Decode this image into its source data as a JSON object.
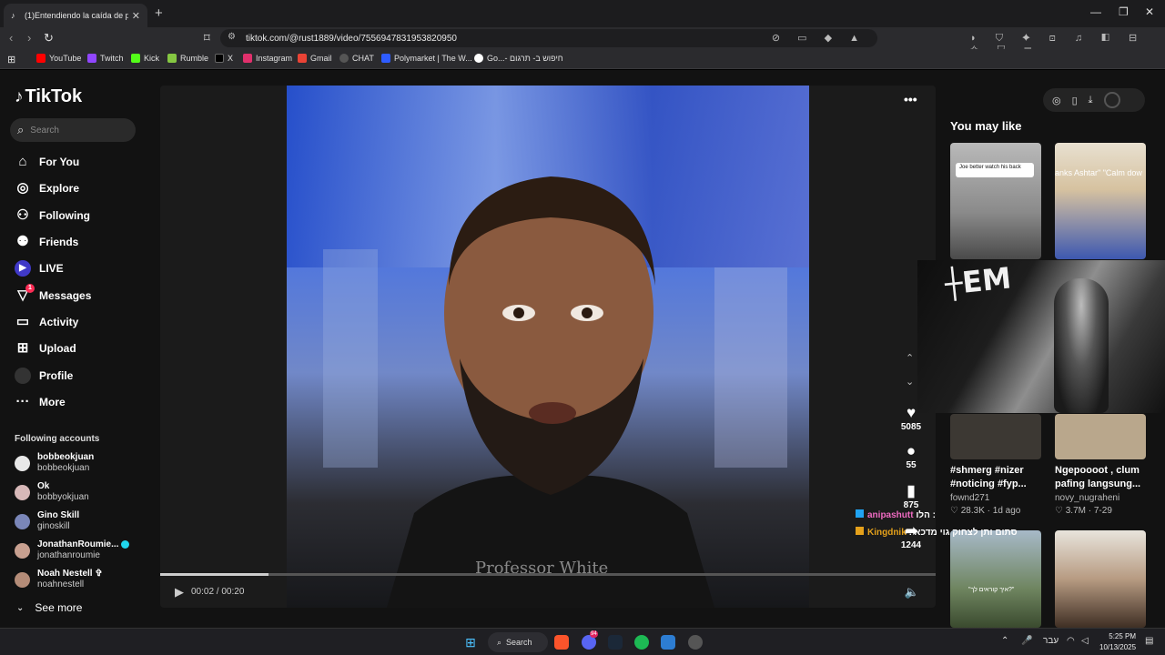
{
  "browser": {
    "tab_title": "(1)Entendiendo la caída de polít",
    "url": "tiktok.com/@rust1889/video/7556947831953820950",
    "bookmarks": [
      "YouTube",
      "Twitch",
      "Kick",
      "Rumble",
      "X",
      "Instagram",
      "Gmail",
      "CHAT",
      "Polymarket | The W...",
      "Go...- חיפוש ב- תרגום"
    ]
  },
  "sidebar": {
    "logo": "TikTok",
    "search_placeholder": "Search",
    "nav": [
      "For You",
      "Explore",
      "Following",
      "Friends",
      "LIVE",
      "Messages",
      "Activity",
      "Upload",
      "Profile",
      "More"
    ],
    "messages_badge": "1",
    "following_header": "Following accounts",
    "accounts": [
      {
        "name": "bobbeokjuan",
        "handle": "bobbeokjuan"
      },
      {
        "name": "Ok",
        "handle": "bobbyokjuan"
      },
      {
        "name": "Gino Skill",
        "handle": "ginoskill"
      },
      {
        "name": "JonathanRoumie...",
        "handle": "jonathanroumie"
      },
      {
        "name": "Noah Nestell ✞",
        "handle": "noahnestell"
      }
    ],
    "see_more": "See more"
  },
  "video": {
    "watermark": "Professor White",
    "time": "00:02 / 00:20",
    "progress": 0.14,
    "author": "rust1889",
    "likes": "5085",
    "comments": "55",
    "saves": "875",
    "shares": "1244"
  },
  "chat": [
    {
      "user": "anipashutt",
      "msg": "הלו :"
    },
    {
      "user": "Kingdnik",
      "msg": ": סתום ותן לצחוק גוי מדכא"
    }
  ],
  "you_may_like": {
    "header": "You may like",
    "cards": [
      {
        "caption": "#shmerg #nizer #noticing #fyp...",
        "user": "fownd271",
        "views": "28.3K",
        "date": "1d ago",
        "overlay_text": "Joe better watch his back"
      },
      {
        "caption": "Ngepoooot , clum pafing langsung...",
        "user": "novy_nugraheni",
        "views": "3.7M",
        "date": "7-29",
        "overlay_text": "anks Ashtar\" \"Calm dow"
      }
    ],
    "bottom_overlay_text": "\"איך קוראים לך?\""
  },
  "taskbar": {
    "search": "Search",
    "language": "עבר",
    "time": "5:25 PM",
    "date": "10/13/2025",
    "discord_badge": "94"
  },
  "colors": {
    "accent": "#fe2c55",
    "chat_user1": "#f06bc2",
    "chat_user2": "#e5a11b"
  }
}
